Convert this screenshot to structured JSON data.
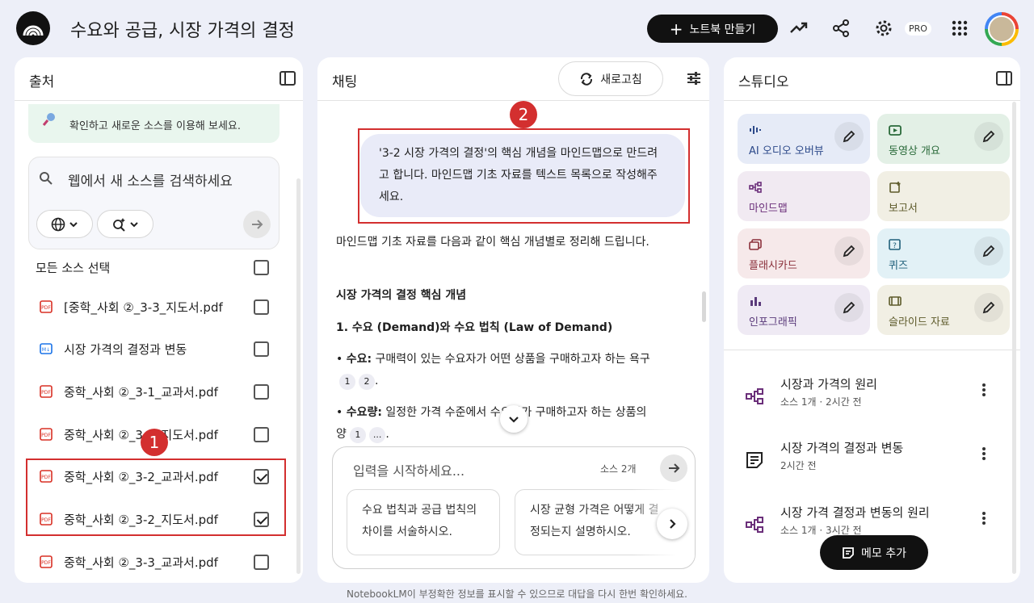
{
  "header": {
    "title": "수요와 공급, 시장 가격의 결정",
    "new_notebook_label": "노트북 만들기",
    "pro_badge": "PRO"
  },
  "sources": {
    "title": "출처",
    "notice": "확인하고 새로운 소스를 이용해 보세요.",
    "search_placeholder": "웹에서 새 소스를 검색하세요",
    "select_all_label": "모든 소스 선택",
    "items": [
      {
        "label": "[중학_사회 ②_3-3_지도서.pdf",
        "type": "pdf",
        "checked": false
      },
      {
        "label": "시장 가격의 결정과 변동",
        "type": "markdown",
        "checked": false
      },
      {
        "label": "중학_사회 ②_3-1_교과서.pdf",
        "type": "pdf",
        "checked": false
      },
      {
        "label": "중학_사회 ②_3-1_지도서.pdf",
        "type": "pdf",
        "checked": false
      },
      {
        "label": "중학_사회 ②_3-2_교과서.pdf",
        "type": "pdf",
        "checked": true
      },
      {
        "label": "중학_사회 ②_3-2_지도서.pdf",
        "type": "pdf",
        "checked": true
      },
      {
        "label": "중학_사회 ②_3-3_교과서.pdf",
        "type": "pdf",
        "checked": false
      }
    ],
    "marker_number": "1"
  },
  "chat": {
    "title": "채팅",
    "refresh_label": "새로고침",
    "marker_number": "2",
    "user_message": "'3-2 시장 가격의 결정'의 핵심 개념을 마인드맵으로 만드려고 합니다. 마인드맵 기초 자료를 텍스트 목록으로 작성해주세요.",
    "response_intro": "마인드맵 기초 자료를 다음과 같이 핵심 개념별로 정리해 드립니다.",
    "response_heading": "시장 가격의 결정 핵심 개념",
    "response_section": "1. 수요 (Demand)와 수요 법칙 (Law of Demand)",
    "bullet1_term": "수요:",
    "bullet1_text": "구매력이 있는 수요자가 어떤 상품을 구매하고자 하는 욕구",
    "bullet1_cites": [
      "1",
      "2"
    ],
    "bullet2_term": "수요량:",
    "bullet2_text": "일정한 가격 수준에서 수요자가 구매하고자 하는 상품의 양",
    "bullet2_cites": [
      "1",
      "..."
    ],
    "composer_placeholder": "입력을 시작하세요...",
    "source_count": "소스 2개",
    "suggestions": [
      "수요 법칙과 공급 법칙의 차이를 서술하시오.",
      "시장 균형 가격은 어떻게 결정되는지 설명하시오."
    ],
    "disclaimer": "NotebookLM이 부정확한 정보를 표시할 수 있으므로 대답을 다시 한번 확인하세요."
  },
  "studio": {
    "title": "스튜디오",
    "tiles": [
      {
        "label": "AI 오디오 오버뷰",
        "color": "#e6ebf7",
        "text_color": "#2d4a8a",
        "icon": "audio-waveform-icon"
      },
      {
        "label": "동영상 개요",
        "color": "#e3f0e6",
        "text_color": "#2a6a3a",
        "icon": "video-icon"
      },
      {
        "label": "마인드맵",
        "color": "#f1eaf2",
        "text_color": "#6b2f7a",
        "icon": "mindmap-icon"
      },
      {
        "label": "보고서",
        "color": "#f1efe4",
        "text_color": "#5d5a2a",
        "icon": "report-icon"
      },
      {
        "label": "플래시카드",
        "color": "#f6e9ea",
        "text_color": "#8a2f3a",
        "icon": "flashcard-icon"
      },
      {
        "label": "퀴즈",
        "color": "#e2f1f6",
        "text_color": "#1f5f7a",
        "icon": "quiz-icon"
      },
      {
        "label": "인포그래픽",
        "color": "#efeaf4",
        "text_color": "#5a3a7a",
        "icon": "infographic-icon"
      },
      {
        "label": "슬라이드 자료",
        "color": "#f1efe4",
        "text_color": "#5d5a2a",
        "icon": "slides-icon"
      }
    ],
    "notes": [
      {
        "title": "시장과 가격의 원리",
        "sub": "소스 1개 · 2시간 전",
        "icon": "mindmap-icon"
      },
      {
        "title": "시장 가격의 결정과 변동",
        "sub": "2시간 전",
        "icon": "note-icon"
      },
      {
        "title": "시장 가격 결정과 변동의 원리",
        "sub": "소스 1개 · 3시간 전",
        "icon": "mindmap-icon"
      }
    ],
    "add_memo_label": "메모 추가"
  }
}
